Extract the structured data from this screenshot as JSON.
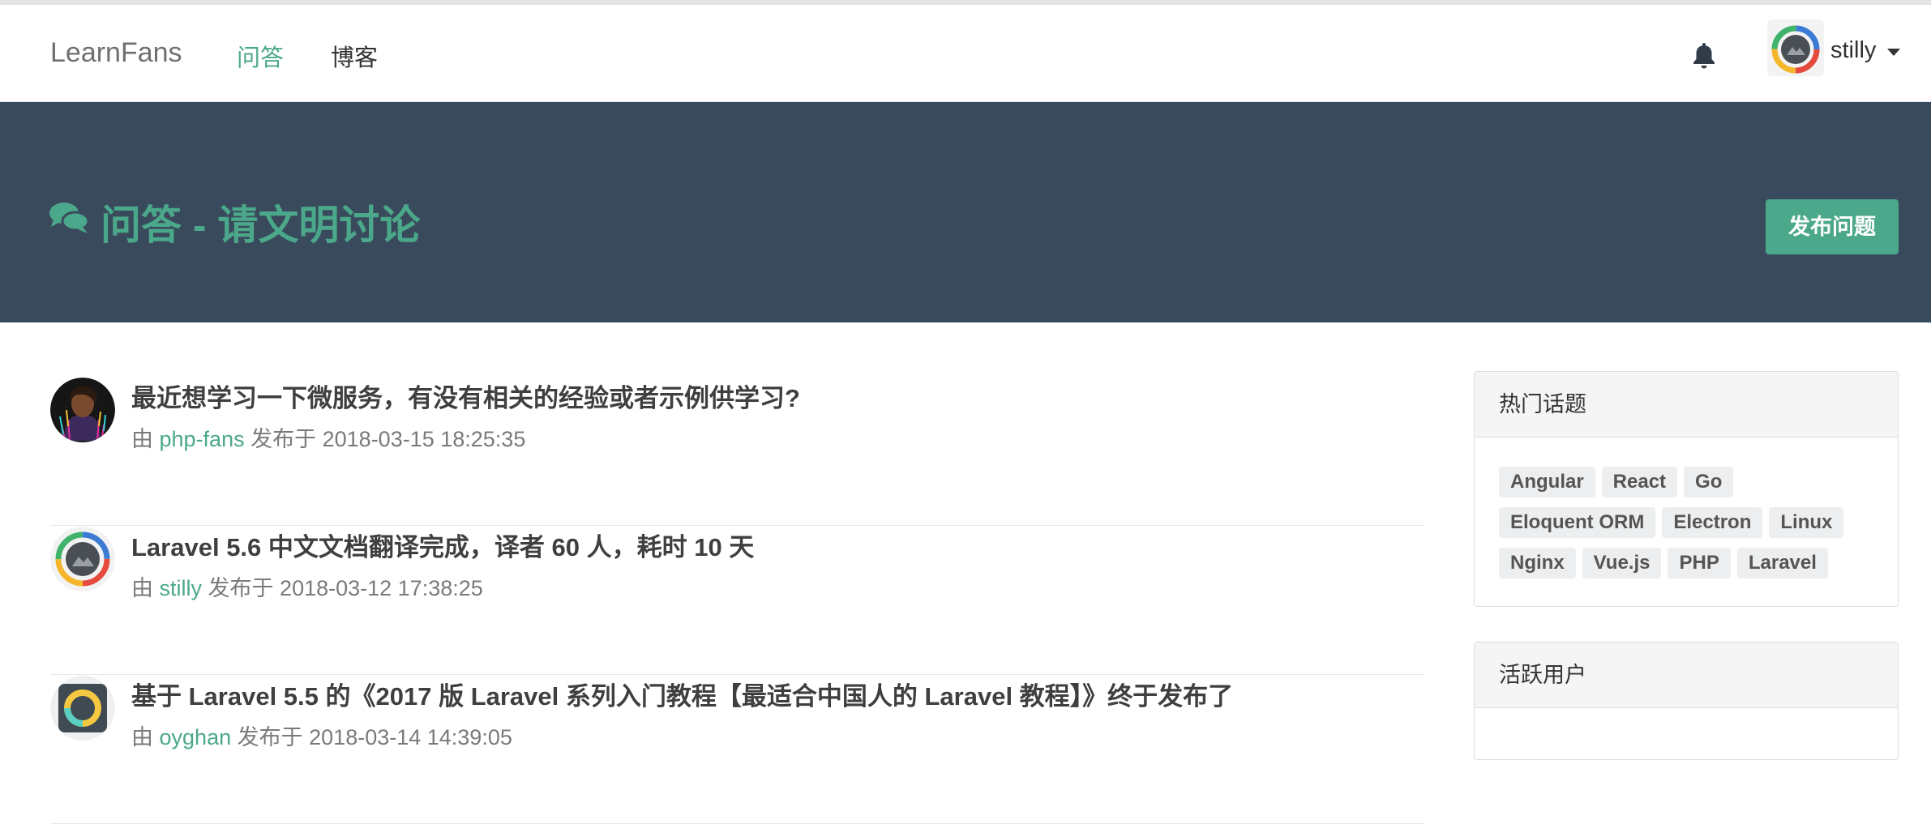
{
  "navbar": {
    "brand": "LearnFans",
    "items": [
      {
        "label": "问答",
        "active": true
      },
      {
        "label": "博客",
        "active": false
      }
    ],
    "user": {
      "name": "stilly"
    }
  },
  "hero": {
    "icon": "comments-icon",
    "title": "问答 - 请文明讨论",
    "publish_button": "发布问题"
  },
  "questions": [
    {
      "title": "最近想学习一下微服务，有没有相关的经验或者示例供学习?",
      "by": "由",
      "author": "php-fans",
      "published": "发布于",
      "datetime": "2018-03-15 18:25:35"
    },
    {
      "title": "Laravel 5.6 中文文档翻译完成，译者 60 人，耗时 10 天",
      "by": "由",
      "author": "stilly",
      "published": "发布于",
      "datetime": "2018-03-12 17:38:25"
    },
    {
      "title": "基于 Laravel 5.5 的《2017 版 Laravel 系列入门教程【最适合中国人的 Laravel 教程】》终于发布了",
      "by": "由",
      "author": "oyghan",
      "published": "发布于",
      "datetime": "2018-03-14 14:39:05"
    }
  ],
  "sidebar": {
    "hot_topics": {
      "title": "热门话题",
      "tags": [
        "Angular",
        "React",
        "Go",
        "Eloquent ORM",
        "Electron",
        "Linux",
        "Nginx",
        "Vue.js",
        "PHP",
        "Laravel"
      ]
    },
    "active_users": {
      "title": "活跃用户"
    }
  },
  "colors": {
    "accent": "#4ba88a",
    "hero_bg": "#394a5c"
  }
}
